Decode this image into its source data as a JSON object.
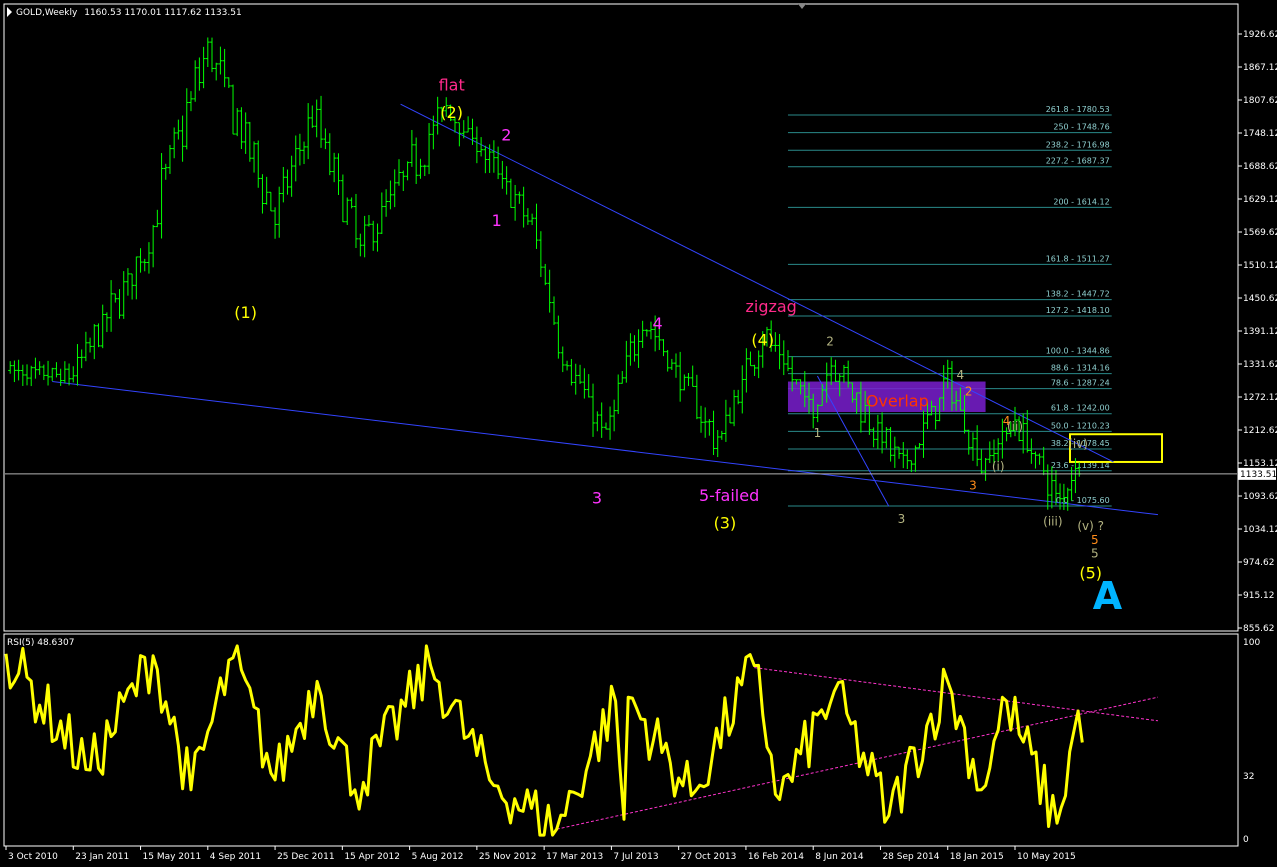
{
  "header": {
    "symbol": "GOLD,Weekly",
    "ohlc": "1160.53 1170.01 1117.62 1133.51"
  },
  "rsi_header": "RSI(5) 48.6307",
  "colors": {
    "background": "#000000",
    "border": "#ffffff",
    "bars": "#00ff00",
    "trend_lines": "#3344ff",
    "fib_lines": "#2a8a8a",
    "fib_text": "#8fd0d0",
    "rsi_line": "#ffff00",
    "rsi_trend": "#ff33cc",
    "label_yellow": "#ffff00",
    "label_magenta": "#ff33ff",
    "label_pink": "#ff2a8a",
    "label_orange": "#ff8c1a",
    "label_olive": "#b4b482",
    "label_red": "#ff3300",
    "overlap_box": "#7a1fd0",
    "highlight_box": "#ffff00",
    "big_letter": "#00b4ff"
  },
  "chart_data": [
    {
      "type": "candlestick",
      "title": "GOLD,Weekly",
      "y_axis_ticks": [
        "1926.62",
        "1867.12",
        "1807.62",
        "1748.12",
        "1688.62",
        "1629.12",
        "1569.62",
        "1510.12",
        "1450.62",
        "1391.12",
        "1331.62",
        "1272.12",
        "1212.62",
        "1153.12",
        "1093.62",
        "1034.12",
        "974.62",
        "915.12",
        "855.62"
      ],
      "ylim": [
        855.62,
        1926.62
      ],
      "x_axis_ticks": [
        "3 Oct 2010",
        "23 Jan 2011",
        "15 May 2011",
        "4 Sep 2011",
        "25 Dec 2011",
        "15 Apr 2012",
        "5 Aug 2012",
        "25 Nov 2012",
        "17 Mar 2013",
        "7 Jul 2013",
        "27 Oct 2013",
        "16 Feb 2014",
        "8 Jun 2014",
        "28 Sep 2014",
        "18 Jan 2015",
        "10 May 2015"
      ],
      "current_price": "1133.51",
      "key_points": [
        {
          "date": "3 Oct 2010",
          "price": 1320
        },
        {
          "date": "23 Jan 2011",
          "price": 1310
        },
        {
          "date": "15 May 2011",
          "price": 1520
        },
        {
          "date": "4 Sep 2011",
          "price": 1900
        },
        {
          "date": "25 Dec 2011",
          "price": 1600
        },
        {
          "date": "25 Feb 2012",
          "price": 1780
        },
        {
          "date": "15 May 2012",
          "price": 1540
        },
        {
          "date": "5 Oct 2012",
          "price": 1790
        },
        {
          "date": "25 Nov 2012",
          "price": 1730
        },
        {
          "date": "25 Feb 2013",
          "price": 1580
        },
        {
          "date": "17 Apr 2013",
          "price": 1350
        },
        {
          "date": "28 Jun 2013",
          "price": 1200
        },
        {
          "date": "28 Aug 2013",
          "price": 1420
        },
        {
          "date": "31 Dec 2013",
          "price": 1190
        },
        {
          "date": "16 Mar 2014",
          "price": 1390
        },
        {
          "date": "8 Jun 2014",
          "price": 1245
        },
        {
          "date": "8 Jul 2014",
          "price": 1340
        },
        {
          "date": "5 Nov 2014",
          "price": 1140
        },
        {
          "date": "18 Jan 2015",
          "price": 1300
        },
        {
          "date": "15 Mar 2015",
          "price": 1150
        },
        {
          "date": "10 May 2015",
          "price": 1230
        },
        {
          "date": "24 Jul 2015",
          "price": 1080
        },
        {
          "date": "25 Aug 2015",
          "price": 1165
        }
      ],
      "fibonacci_levels": [
        {
          "label": "261.8 - 1780.53",
          "price": 1780.53
        },
        {
          "label": "250 - 1748.76",
          "price": 1748.76
        },
        {
          "label": "238.2 - 1716.98",
          "price": 1716.98
        },
        {
          "label": "227.2 - 1687.37",
          "price": 1687.37
        },
        {
          "label": "200 - 1614.12",
          "price": 1614.12
        },
        {
          "label": "161.8 - 1511.27",
          "price": 1511.27
        },
        {
          "label": "138.2 - 1447.72",
          "price": 1447.72
        },
        {
          "label": "127.2 - 1418.10",
          "price": 1418.1
        },
        {
          "label": "100.0 - 1344.86",
          "price": 1344.86
        },
        {
          "label": "88.6 - 1314.16",
          "price": 1314.16
        },
        {
          "label": "78.6 - 1287.24",
          "price": 1287.24
        },
        {
          "label": "61.8 - 1242.00",
          "price": 1242.0
        },
        {
          "label": "50.0 - 1210.23",
          "price": 1210.23
        },
        {
          "label": "38.2 - 1178.45",
          "price": 1178.45
        },
        {
          "label": "23.6 - 1139.14",
          "price": 1139.14
        },
        {
          "label": "0.0 - 1075.60",
          "price": 1075.6
        }
      ],
      "fib_range": {
        "from": "27 Apr 2014",
        "to": "18 Oct 2015"
      },
      "trend_lines": [
        {
          "from": {
            "date": "21 Jul 2012",
            "price": 1800
          },
          "to": {
            "date": "21 Oct 2015",
            "price": 1155
          }
        },
        {
          "from": {
            "date": "19 Dec 2010",
            "price": 1300
          },
          "to": {
            "date": "3 Jan 2016",
            "price": 1060
          }
        },
        {
          "from": {
            "date": "15 Jun 2014",
            "price": 1310
          },
          "to": {
            "date": "12 Oct 2014",
            "price": 1075
          }
        }
      ],
      "annotations": [
        {
          "text": "flat",
          "date": "14 Oct 2012",
          "price": 1825,
          "color": "label_pink"
        },
        {
          "text": "(2)",
          "date": "14 Oct 2012",
          "price": 1775,
          "color": "label_yellow"
        },
        {
          "text": "2",
          "date": "13 Jan 2013",
          "price": 1735,
          "color": "label_magenta"
        },
        {
          "text": "1",
          "date": "28 Dec 2012",
          "price": 1580,
          "color": "label_magenta"
        },
        {
          "text": "(1)",
          "date": "6 Nov 2011",
          "price": 1415,
          "color": "label_yellow"
        },
        {
          "text": "4",
          "date": "22 Sep 2013",
          "price": 1395,
          "color": "label_magenta"
        },
        {
          "text": "zigzag",
          "date": "30 Mar 2014",
          "price": 1425,
          "color": "label_pink"
        },
        {
          "text": "(4)",
          "date": "16 Mar 2014",
          "price": 1365,
          "color": "label_yellow"
        },
        {
          "text": "3",
          "date": "13 Jun 2013",
          "price": 1080,
          "color": "label_magenta"
        },
        {
          "text": "5-failed",
          "date": "19 Jan 2014",
          "price": 1085,
          "color": "label_magenta"
        },
        {
          "text": "(3)",
          "date": "12 Jan 2014",
          "price": 1035,
          "color": "label_yellow"
        },
        {
          "text": "2",
          "date": "6 Jul 2014",
          "price": 1365,
          "color": "label_olive"
        },
        {
          "text": "1",
          "date": "15 Jun 2014",
          "price": 1200,
          "color": "label_olive"
        },
        {
          "text": "3",
          "date": "2 Nov 2014",
          "price": 1045,
          "color": "label_olive"
        },
        {
          "text": "4",
          "date": "8 Feb 2015",
          "price": 1305,
          "color": "label_olive"
        },
        {
          "text": "Overlap",
          "date": "26 Oct 2014",
          "price": 1255,
          "color": "label_red"
        },
        {
          "text": "2",
          "date": "22 Feb 2015",
          "price": 1275,
          "color": "label_orange"
        },
        {
          "text": "4",
          "date": "26 Apr 2015",
          "price": 1222,
          "color": "label_orange"
        },
        {
          "text": "3",
          "date": "1 Mar 2015",
          "price": 1105,
          "color": "label_orange"
        },
        {
          "text": "(ii)",
          "date": "10 May 2015",
          "price": 1212,
          "color": "label_olive"
        },
        {
          "text": "(i)",
          "date": "12 Apr 2015",
          "price": 1140,
          "color": "label_olive"
        },
        {
          "text": "(iv)",
          "date": "23 Aug 2015",
          "price": 1180,
          "color": "label_olive"
        },
        {
          "text": "(iii)",
          "date": "12 Jul 2015",
          "price": 1040,
          "color": "label_olive"
        },
        {
          "text": "(v) ?",
          "date": "13 Sep 2015",
          "price": 1032,
          "color": "label_olive"
        },
        {
          "text": "5",
          "date": "20 Sep 2015",
          "price": 1007,
          "color": "label_orange"
        },
        {
          "text": "5",
          "date": "20 Sep 2015",
          "price": 983,
          "color": "label_olive"
        },
        {
          "text": "(5)",
          "date": "13 Sep 2015",
          "price": 945,
          "color": "label_yellow"
        },
        {
          "text": "A",
          "date": "11 Oct 2015",
          "price": 890,
          "color": "big_letter"
        }
      ],
      "overlap_zone": {
        "from": "27 Apr 2014",
        "to": "22 Mar 2015",
        "price_top": 1300,
        "price_bottom": 1245
      },
      "highlight_zone": {
        "price_top": 1205,
        "price_bottom": 1155
      }
    },
    {
      "type": "line",
      "title": "RSI(5) 48.6307",
      "y_axis_ticks": [
        "100",
        "32",
        "0"
      ],
      "ylim": [
        0,
        100
      ],
      "key_points": [
        {
          "date": "3 Oct 2010",
          "value": 94
        },
        {
          "date": "20 Feb 2011",
          "value": 35
        },
        {
          "date": "5 Jun 2011",
          "value": 93
        },
        {
          "date": "7 Aug 2011",
          "value": 25
        },
        {
          "date": "16 Oct 2011",
          "value": 92
        },
        {
          "date": "25 Dec 2011",
          "value": 30
        },
        {
          "date": "4 Mar 2012",
          "value": 80
        },
        {
          "date": "6 May 2012",
          "value": 25
        },
        {
          "date": "9 Sep 2012",
          "value": 88
        },
        {
          "date": "16 Dec 2012",
          "value": 30
        },
        {
          "date": "7 Apr 2013",
          "value": 5
        },
        {
          "date": "14 Jul 2013",
          "value": 70
        },
        {
          "date": "28 Jul 2013",
          "value": 10
        },
        {
          "date": "4 Aug 2013",
          "value": 72
        },
        {
          "date": "17 Nov 2013",
          "value": 22
        },
        {
          "date": "2 Mar 2014",
          "value": 88
        },
        {
          "date": "13 Apr 2014",
          "value": 20
        },
        {
          "date": "13 Jul 2014",
          "value": 75
        },
        {
          "date": "12 Oct 2014",
          "value": 12
        },
        {
          "date": "18 Jan 2015",
          "value": 80
        },
        {
          "date": "15 Mar 2015",
          "value": 25
        },
        {
          "date": "26 Apr 2015",
          "value": 70
        },
        {
          "date": "19 Jul 2015",
          "value": 8
        },
        {
          "date": "23 Aug 2015",
          "value": 65
        },
        {
          "date": "30 Aug 2015",
          "value": 49
        }
      ],
      "trend_lines": [
        {
          "from": {
            "date": "7 Apr 2013",
            "value": 5
          },
          "to": {
            "date": "3 Jan 2016",
            "value": 72
          }
        },
        {
          "from": {
            "date": "2 Mar 2014",
            "value": 87
          },
          "to": {
            "date": "3 Jan 2016",
            "value": 60
          }
        }
      ]
    }
  ]
}
